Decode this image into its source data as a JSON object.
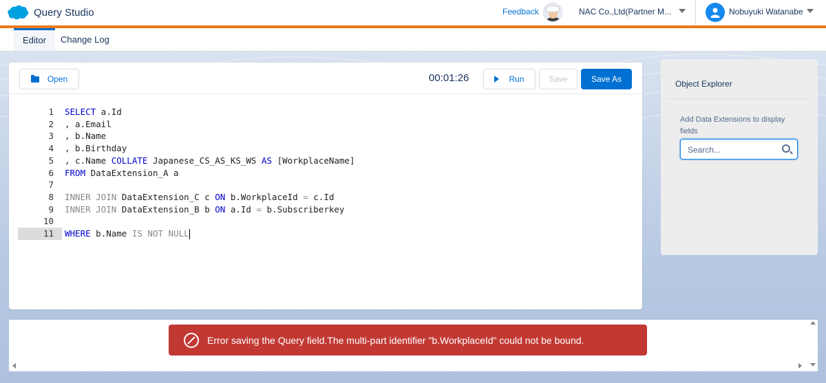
{
  "header": {
    "app_title": "Query Studio",
    "feedback_label": "Feedback",
    "org_name": "NAC Co.,Ltd(Partner M...",
    "user_name": "Nobuyuki Watanabe"
  },
  "tabs": [
    {
      "label": "Editor",
      "active": true
    },
    {
      "label": "Change Log",
      "active": false
    }
  ],
  "toolbar": {
    "open_label": "Open",
    "timer": "00:01:26",
    "run_label": "Run",
    "save_label": "Save",
    "save_as_label": "Save As"
  },
  "editor": {
    "active_line": 11,
    "lines": [
      {
        "n": "1",
        "tokens": [
          {
            "t": "SELECT",
            "c": "kw"
          },
          {
            "t": " a.Id",
            "c": ""
          }
        ]
      },
      {
        "n": "2",
        "tokens": [
          {
            "t": ", a.Email",
            "c": ""
          }
        ]
      },
      {
        "n": "3",
        "tokens": [
          {
            "t": ", b.Name",
            "c": ""
          }
        ]
      },
      {
        "n": "4",
        "tokens": [
          {
            "t": ", b.Birthday",
            "c": ""
          }
        ]
      },
      {
        "n": "5",
        "tokens": [
          {
            "t": ", c.Name ",
            "c": ""
          },
          {
            "t": "COLLATE",
            "c": "kw"
          },
          {
            "t": " Japanese_CS_AS_KS_WS ",
            "c": ""
          },
          {
            "t": "AS",
            "c": "kw"
          },
          {
            "t": " [WorkplaceName]",
            "c": ""
          }
        ]
      },
      {
        "n": "6",
        "tokens": [
          {
            "t": "FROM",
            "c": "kw"
          },
          {
            "t": " DataExtension_A a",
            "c": ""
          }
        ]
      },
      {
        "n": "7",
        "tokens": []
      },
      {
        "n": "8",
        "tokens": [
          {
            "t": "INNER JOIN",
            "c": "kwg"
          },
          {
            "t": " DataExtension_C c ",
            "c": ""
          },
          {
            "t": "ON",
            "c": "kw"
          },
          {
            "t": " b.WorkplaceId ",
            "c": ""
          },
          {
            "t": "=",
            "c": "kwg"
          },
          {
            "t": " c.Id",
            "c": ""
          }
        ]
      },
      {
        "n": "9",
        "tokens": [
          {
            "t": "INNER JOIN",
            "c": "kwg"
          },
          {
            "t": " DataExtension_B b ",
            "c": ""
          },
          {
            "t": "ON",
            "c": "kw"
          },
          {
            "t": " a.Id ",
            "c": ""
          },
          {
            "t": "=",
            "c": "kwg"
          },
          {
            "t": " b.Subscriberkey",
            "c": ""
          }
        ]
      },
      {
        "n": "10",
        "tokens": []
      },
      {
        "n": "11",
        "tokens": [
          {
            "t": "WHERE",
            "c": "kw"
          },
          {
            "t": " b.Name ",
            "c": ""
          },
          {
            "t": "IS NOT NULL",
            "c": "kwg"
          }
        ]
      }
    ]
  },
  "explorer": {
    "title": "Object Explorer",
    "hint": "Add Data Extensions to display fields",
    "search_placeholder": "Search..."
  },
  "error": {
    "message": "Error saving the Query field.The multi-part identifier \"b.WorkplaceId\" could not be bound."
  },
  "colors": {
    "brand_blue": "#0070d2",
    "accent_orange": "#e97a1a",
    "error_red": "#c23934"
  }
}
